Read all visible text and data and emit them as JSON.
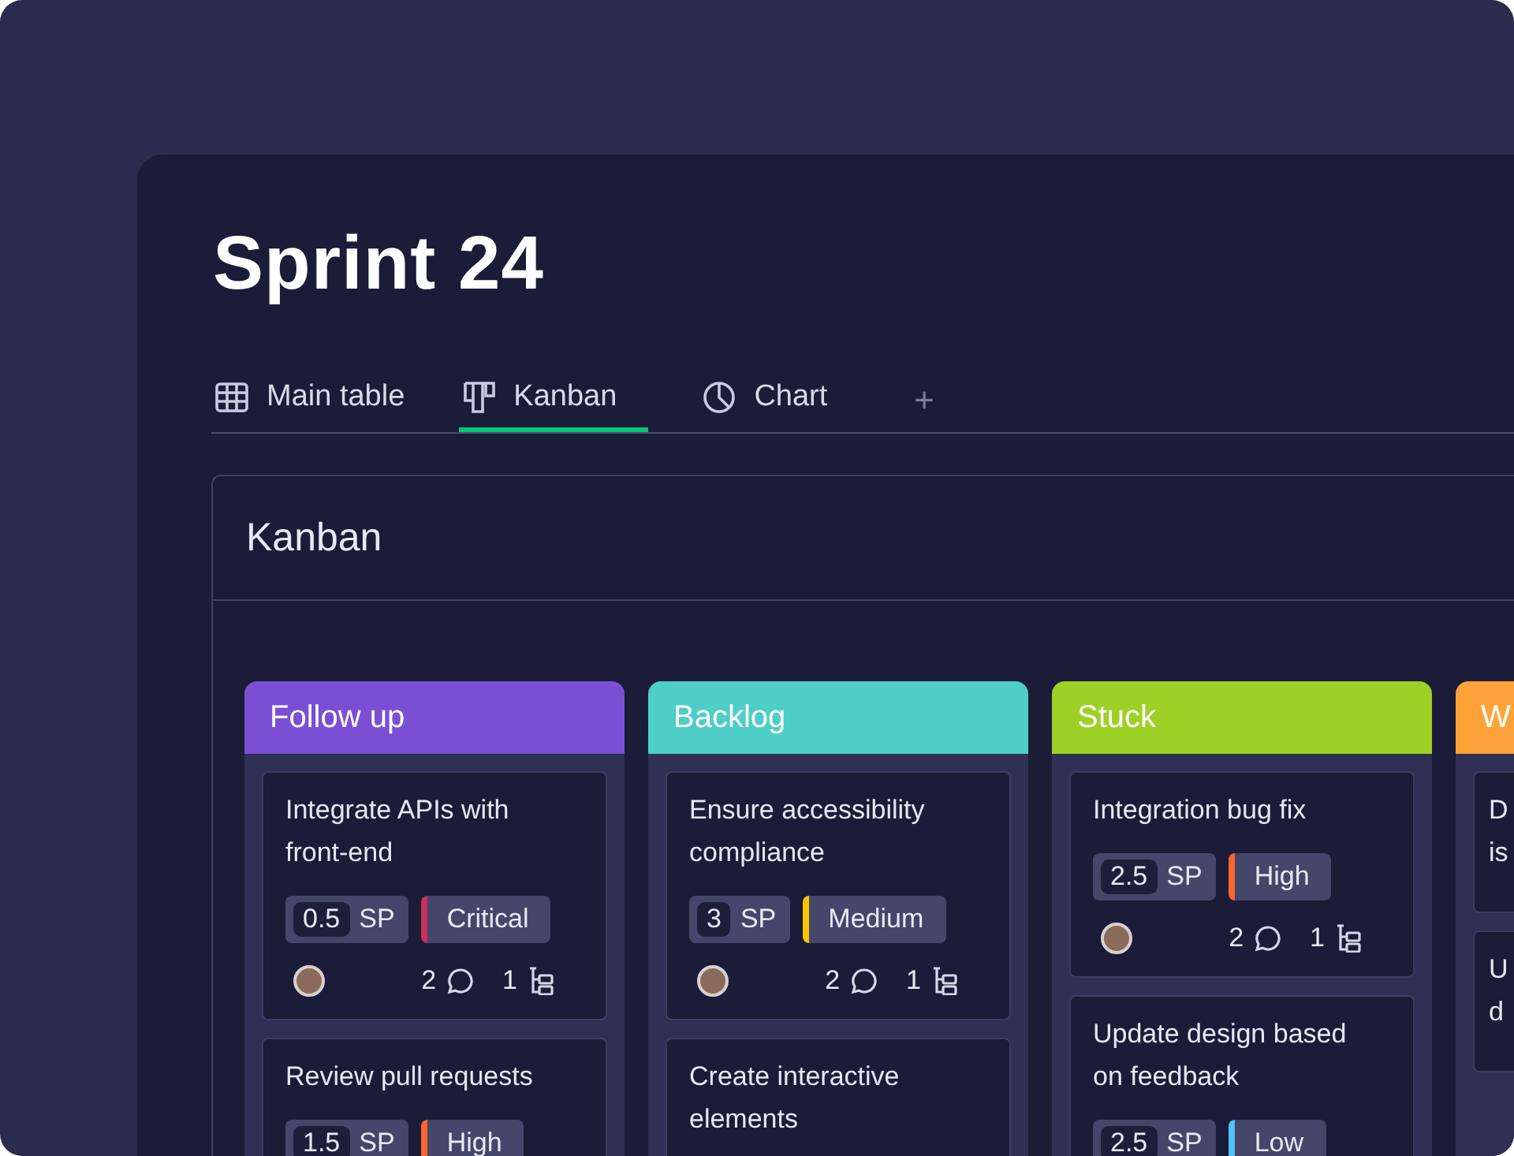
{
  "title": "Sprint 24",
  "tabs": [
    {
      "label": "Main table",
      "kind": "table",
      "selected": false
    },
    {
      "label": "Kanban",
      "kind": "kanban",
      "selected": true
    },
    {
      "label": "Chart",
      "kind": "chart",
      "selected": false
    }
  ],
  "add_tab": "+",
  "board": {
    "title": "Kanban",
    "columns": [
      {
        "title": "Follow up",
        "color": "#7b4fd4",
        "cards": [
          {
            "title": "Integrate APIs with front-end",
            "points": "0.5",
            "unit": "SP",
            "priority": {
              "label": "Critical",
              "color": "#c8325a"
            },
            "footer": {
              "comments": "2",
              "subitems": "1"
            }
          },
          {
            "title": "Review pull requests",
            "points": "1.5",
            "unit": "SP",
            "priority": {
              "label": "High",
              "color": "#ff642e"
            }
          }
        ]
      },
      {
        "title": "Backlog",
        "color": "#4fcdc7",
        "cards": [
          {
            "title": "Ensure accessibility compliance",
            "points": "3",
            "unit": "SP",
            "priority": {
              "label": "Medium",
              "color": "#fdc500"
            },
            "footer": {
              "comments": "2",
              "subitems": "1"
            }
          },
          {
            "title": "Create interactive elements"
          }
        ]
      },
      {
        "title": "Stuck",
        "color": "#9ed126",
        "cards": [
          {
            "title": "Integration bug fix",
            "points": "2.5",
            "unit": "SP",
            "priority": {
              "label": "High",
              "color": "#ff642e"
            },
            "footer": {
              "comments": "2",
              "subitems": "1"
            }
          },
          {
            "title": "Update design based on feedback",
            "points": "2.5",
            "unit": "SP",
            "priority": {
              "label": "Low",
              "color": "#4ec3f7"
            }
          }
        ]
      },
      {
        "title": "W",
        "color": "#fda33a",
        "cut": true,
        "cards": [
          {
            "title": "D is"
          },
          {
            "title": "U d"
          }
        ]
      }
    ]
  }
}
